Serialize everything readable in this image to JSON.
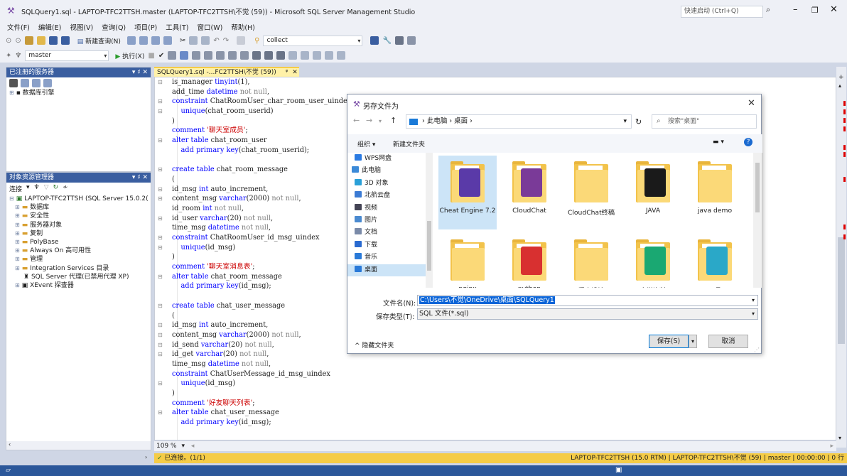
{
  "window": {
    "title": "SQLQuery1.sql - LAPTOP-TFC2TTSH.master (LAPTOP-TFC2TTSH\\不觉 (59)) - Microsoft SQL Server Management Studio",
    "quick_launch_placeholder": "快速启动 (Ctrl+Q)"
  },
  "menu": [
    "文件(F)",
    "编辑(E)",
    "视图(V)",
    "查询(Q)",
    "项目(P)",
    "工具(T)",
    "窗口(W)",
    "帮助(H)"
  ],
  "toolbar": {
    "new_query": "新建查询(N)",
    "solution_combo": "collect",
    "db_combo": "master",
    "execute": "执行(X)"
  },
  "registered_servers": {
    "title": "已注册的服务器",
    "pin": "▾ ♯ ✕",
    "items": [
      "数据库引擎"
    ]
  },
  "object_explorer": {
    "title": "对象资源管理器",
    "connect": "连接",
    "root": "LAPTOP-TFC2TTSH (SQL Server 15.0.2(",
    "items": [
      "数据库",
      "安全性",
      "服务器对象",
      "复制",
      "PolyBase",
      "Always On 高可用性",
      "管理",
      "Integration Services 目录"
    ],
    "agent": "SQL Server 代理(已禁用代理 XP)",
    "xevent": "XEvent 探查器"
  },
  "doc_tab": {
    "label": "SQLQuery1.sql -...FC2TTSH\\不觉 (59))"
  },
  "code_lines": [
    [
      [
        "t",
        "is_manager "
      ],
      [
        "tp",
        "tinyint"
      ],
      [
        "t",
        "("
      ],
      [
        "t",
        "1"
      ],
      [
        "t",
        "),"
      ]
    ],
    [
      [
        "t",
        "add_time "
      ],
      [
        "tp",
        "datetime "
      ],
      [
        "cm",
        "not null"
      ],
      [
        "t",
        ","
      ]
    ],
    [
      [
        "kw",
        "constraint "
      ],
      [
        "t",
        "ChatRoomUser_char_room_user_uinde"
      ]
    ],
    [
      [
        "t",
        "    "
      ],
      [
        "kw",
        "unique"
      ],
      [
        "t",
        "(chat_room_userid)"
      ]
    ],
    [
      [
        "t",
        ")"
      ]
    ],
    [
      [
        "kw",
        "comment "
      ],
      [
        "str",
        "'聊天室成员'"
      ],
      [
        "t",
        ";"
      ]
    ],
    [
      [
        "kw",
        "alter table "
      ],
      [
        "t",
        "chat_room_user"
      ]
    ],
    [
      [
        "t",
        "    "
      ],
      [
        "kw",
        "add primary key"
      ],
      [
        "t",
        "(chat_room_userid);"
      ]
    ],
    [
      [
        "t",
        ""
      ]
    ],
    [
      [
        "kw",
        "create table "
      ],
      [
        "t",
        "chat_room_message"
      ]
    ],
    [
      [
        "t",
        "("
      ]
    ],
    [
      [
        "t",
        "id_msg "
      ],
      [
        "tp",
        "int "
      ],
      [
        "t",
        "auto_increment,"
      ]
    ],
    [
      [
        "t",
        "content_msg "
      ],
      [
        "tp",
        "varchar"
      ],
      [
        "t",
        "(2000) "
      ],
      [
        "cm",
        "not null"
      ],
      [
        "t",
        ","
      ]
    ],
    [
      [
        "t",
        "id_room "
      ],
      [
        "tp",
        "int "
      ],
      [
        "cm",
        "not null"
      ],
      [
        "t",
        ","
      ]
    ],
    [
      [
        "t",
        "id_user "
      ],
      [
        "tp",
        "varchar"
      ],
      [
        "t",
        "(20) "
      ],
      [
        "cm",
        "not null"
      ],
      [
        "t",
        ","
      ]
    ],
    [
      [
        "t",
        "time_msg "
      ],
      [
        "tp",
        "datetime "
      ],
      [
        "cm",
        "not null"
      ],
      [
        "t",
        ","
      ]
    ],
    [
      [
        "kw",
        "constraint "
      ],
      [
        "t",
        "ChatRoomUser_id_msg_uindex"
      ]
    ],
    [
      [
        "t",
        "    "
      ],
      [
        "kw",
        "unique"
      ],
      [
        "t",
        "(id_msg)"
      ]
    ],
    [
      [
        "t",
        ")"
      ]
    ],
    [
      [
        "kw",
        "comment "
      ],
      [
        "str",
        "'聊天室消息表'"
      ],
      [
        "t",
        ";"
      ]
    ],
    [
      [
        "kw",
        "alter table "
      ],
      [
        "t",
        "chat_room_message"
      ]
    ],
    [
      [
        "t",
        "    "
      ],
      [
        "kw",
        "add primary key"
      ],
      [
        "t",
        "(id_msg);"
      ]
    ],
    [
      [
        "t",
        ""
      ]
    ],
    [
      [
        "kw",
        "create table "
      ],
      [
        "t",
        "chat_user_message"
      ]
    ],
    [
      [
        "t",
        "("
      ]
    ],
    [
      [
        "t",
        "id_msg "
      ],
      [
        "tp",
        "int "
      ],
      [
        "t",
        "auto_increment,"
      ]
    ],
    [
      [
        "t",
        "content_msg "
      ],
      [
        "tp",
        "varchar"
      ],
      [
        "t",
        "(2000) "
      ],
      [
        "cm",
        "not null"
      ],
      [
        "t",
        ","
      ]
    ],
    [
      [
        "t",
        "id_send "
      ],
      [
        "tp",
        "varchar"
      ],
      [
        "t",
        "(20) "
      ],
      [
        "cm",
        "not null"
      ],
      [
        "t",
        ","
      ]
    ],
    [
      [
        "t",
        "id_get "
      ],
      [
        "tp",
        "varchar"
      ],
      [
        "t",
        "(20) "
      ],
      [
        "cm",
        "not null"
      ],
      [
        "t",
        ","
      ]
    ],
    [
      [
        "t",
        "time_msg "
      ],
      [
        "tp",
        "datetime "
      ],
      [
        "cm",
        "not null"
      ],
      [
        "t",
        ","
      ]
    ],
    [
      [
        "kw",
        "constraint "
      ],
      [
        "t",
        "ChatUserMessage_id_msg_uindex"
      ]
    ],
    [
      [
        "t",
        "    "
      ],
      [
        "kw",
        "unique"
      ],
      [
        "t",
        "(id_msg)"
      ]
    ],
    [
      [
        "t",
        ")"
      ]
    ],
    [
      [
        "kw",
        "comment "
      ],
      [
        "str",
        "'好友聊天列表'"
      ],
      [
        "t",
        ";"
      ]
    ],
    [
      [
        "kw",
        "alter table "
      ],
      [
        "t",
        "chat_user_message"
      ]
    ],
    [
      [
        "t",
        "    "
      ],
      [
        "kw",
        "add primary key"
      ],
      [
        "t",
        "(id_msg);"
      ]
    ]
  ],
  "editor": {
    "zoom": "109 %"
  },
  "status": {
    "connected": "已连接。(1/1)",
    "server": "LAPTOP-TFC2TTSH (15.0 RTM)",
    "user": "LAPTOP-TFC2TTSH\\不觉 (59)",
    "db": "master",
    "time": "00:00:00",
    "rows": "0 行"
  },
  "dialog": {
    "title": "另存文件为",
    "breadcrumb": "›  此电脑  ›  桌面  ›",
    "search_placeholder": "搜索\"桌面\"",
    "organize": "组织 ▾",
    "new_folder": "新建文件夹",
    "nav": [
      {
        "label": "WPS网盘",
        "color": "#2a7ae2"
      },
      {
        "label": "此电脑",
        "color": "#3c8ad8"
      },
      {
        "label": "3D 对象",
        "color": "#2aa0d8"
      },
      {
        "label": "北航云盘",
        "color": "#3b7bd4"
      },
      {
        "label": "视频",
        "color": "#445"
      },
      {
        "label": "图片",
        "color": "#4a8ad0"
      },
      {
        "label": "文档",
        "color": "#7a8aa8"
      },
      {
        "label": "下载",
        "color": "#2a6ad0"
      },
      {
        "label": "音乐",
        "color": "#2a7ad8"
      },
      {
        "label": "桌面",
        "color": "#2a7ad8"
      }
    ],
    "files": [
      {
        "name": "Cheat Engine 7.2",
        "badge": "#5a3aa8"
      },
      {
        "name": "CloudChat",
        "badge": "#7a3a98"
      },
      {
        "name": "CloudChat终稿",
        "badge": ""
      },
      {
        "name": "JAVA",
        "badge": "#1a1a1a"
      },
      {
        "name": "java demo",
        "badge": ""
      },
      {
        "name": "nginx",
        "badge": ""
      },
      {
        "name": "python",
        "badge": "#d83030"
      },
      {
        "name": "程序设计",
        "badge": ""
      },
      {
        "name": "大学资料",
        "badge": "#1aa872"
      },
      {
        "name": "工具",
        "badge": "#2aa8c8"
      }
    ],
    "filename_label": "文件名(N):",
    "filename_value": "C:\\Users\\不觉\\OneDrive\\桌面\\SQLQuery1",
    "filetype_label": "保存类型(T):",
    "filetype_value": "SQL 文件(*.sql)",
    "hide_folders": "隐藏文件夹",
    "save": "保存(S)",
    "cancel": "取消"
  }
}
